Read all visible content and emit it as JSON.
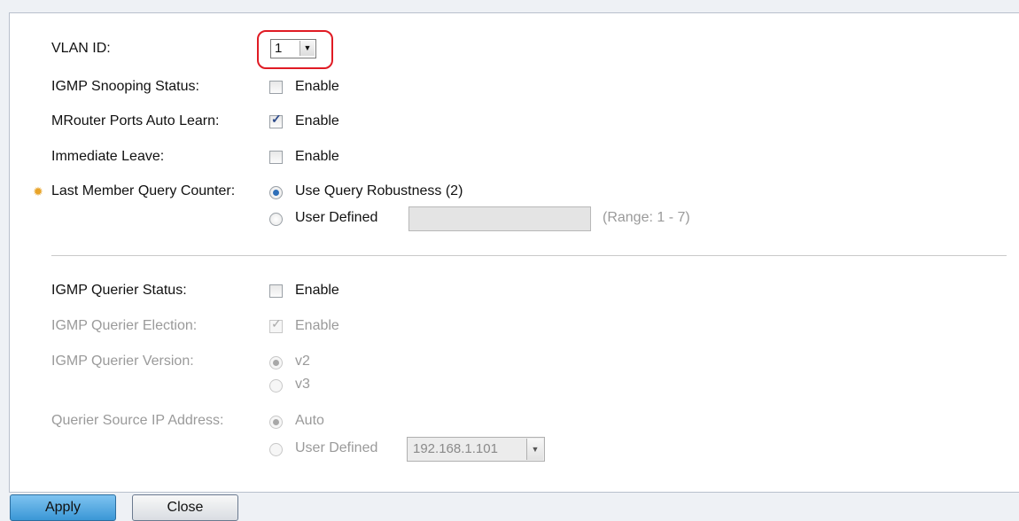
{
  "form": {
    "vlan_id_label": "VLAN ID:",
    "vlan_id_value": "1",
    "igmp_snooping_label": "IGMP Snooping Status:",
    "igmp_snooping_enable": "Enable",
    "mrouter_label": "MRouter Ports Auto Learn:",
    "mrouter_enable": "Enable",
    "immediate_leave_label": "Immediate Leave:",
    "immediate_leave_enable": "Enable",
    "lmqc_label": "Last Member Query Counter:",
    "lmqc_option1": "Use Query Robustness (2)",
    "lmqc_option2": "User Defined",
    "lmqc_range": "(Range: 1 - 7)",
    "querier_status_label": "IGMP Querier Status:",
    "querier_status_enable": "Enable",
    "querier_election_label": "IGMP Querier Election:",
    "querier_election_enable": "Enable",
    "querier_version_label": "IGMP Querier Version:",
    "querier_version_v2": "v2",
    "querier_version_v3": "v3",
    "querier_source_label": "Querier Source IP Address:",
    "querier_source_auto": "Auto",
    "querier_source_user": "User Defined",
    "querier_source_ip": "192.168.1.101"
  },
  "buttons": {
    "apply": "Apply",
    "close": "Close"
  },
  "icons": {
    "required": "gear-icon"
  }
}
